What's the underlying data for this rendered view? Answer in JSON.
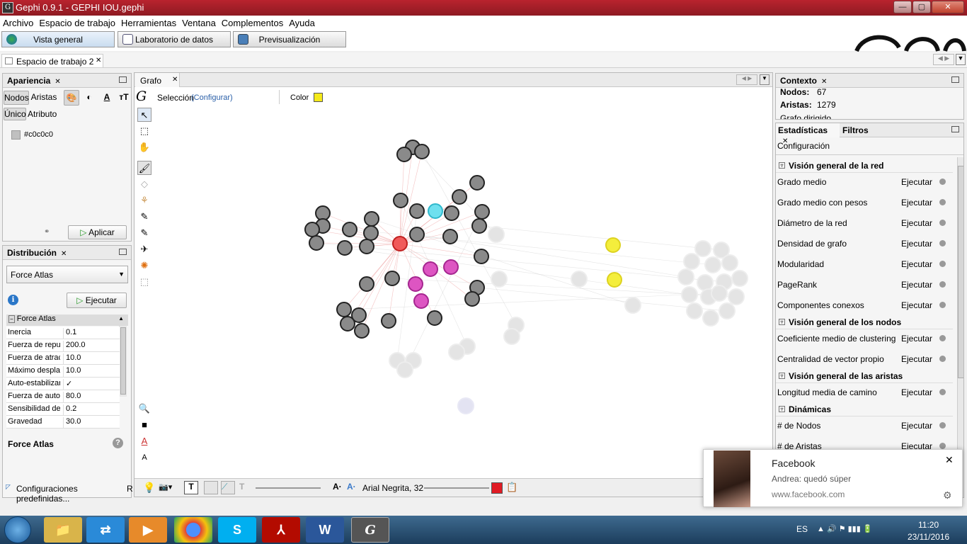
{
  "window": {
    "title": "Gephi 0.9.1 - GEPHI IOU.gephi",
    "app_icon": "gephi-icon"
  },
  "menu": [
    "Archivo",
    "Espacio de trabajo",
    "Herramientas",
    "Ventana",
    "Complementos",
    "Ayuda"
  ],
  "modes": {
    "overview": "Vista general",
    "data_lab": "Laboratorio de datos",
    "preview": "Previsualización"
  },
  "workspace_tab": "Espacio de trabajo 2",
  "appearance": {
    "title": "Apariencia",
    "tab_nodes": "Nodos",
    "tab_edges": "Aristas",
    "tab_unique": "Único",
    "tab_attribute": "Atributo",
    "color_value": "#c0c0c0",
    "apply": "Aplicar"
  },
  "layout": {
    "title": "Distribución",
    "algorithm": "Force Atlas",
    "run": "Ejecutar",
    "group": "Force Atlas",
    "props": [
      {
        "k": "Inercia",
        "v": "0.1"
      },
      {
        "k": "Fuerza de repulsión",
        "v": "200.0"
      },
      {
        "k": "Fuerza de atracción",
        "v": "10.0"
      },
      {
        "k": "Máximo desplazamiento",
        "v": "10.0"
      },
      {
        "k": "Auto-estabilizar",
        "v": "✓"
      },
      {
        "k": "Fuerza de autoestabilización",
        "v": "80.0"
      },
      {
        "k": "Sensibilidad de",
        "v": "0.2"
      },
      {
        "k": "Gravedad",
        "v": "30.0"
      }
    ],
    "desc_title": "Force Atlas",
    "presets": "Configuraciones predefinidas...",
    "presets_tail": "R"
  },
  "graph": {
    "title": "Grafo",
    "selection": "Selección",
    "configure": "(Configurar)",
    "color": "Color",
    "color_swatch": "#f5ea1a",
    "font_label": "Arial Negrita, 32",
    "label_color": "#e01b24"
  },
  "context": {
    "title": "Contexto",
    "nodes_label": "Nodos:",
    "nodes": "67",
    "edges_label": "Aristas:",
    "edges": "1279",
    "directed": "Grafo dirigido"
  },
  "statistics": {
    "tab_stats": "Estadísticas",
    "tab_filters": "Filtros",
    "config": "Configuración",
    "sections": [
      {
        "title": "Visión general de la red",
        "items": [
          "Grado medio",
          "Grado medio con pesos",
          "Diámetro de la red",
          "Densidad de grafo",
          "Modularidad",
          "PageRank",
          "Componentes conexos"
        ]
      },
      {
        "title": "Visión general de los nodos",
        "items": [
          "Coeficiente medio de clustering",
          "Centralidad de vector propio"
        ]
      },
      {
        "title": "Visión general de las aristas",
        "items": [
          "Longitud media de camino"
        ]
      },
      {
        "title": "Dinámicas",
        "items": [
          "# de Nodos",
          "# de Aristas"
        ]
      }
    ],
    "run": "Ejecutar"
  },
  "notification": {
    "app": "Facebook",
    "message": "Andrea: quedó súper",
    "site": "www.facebook.com"
  },
  "taskbar": {
    "lang": "ES",
    "time": "11:20",
    "date": "23/11/2016"
  }
}
